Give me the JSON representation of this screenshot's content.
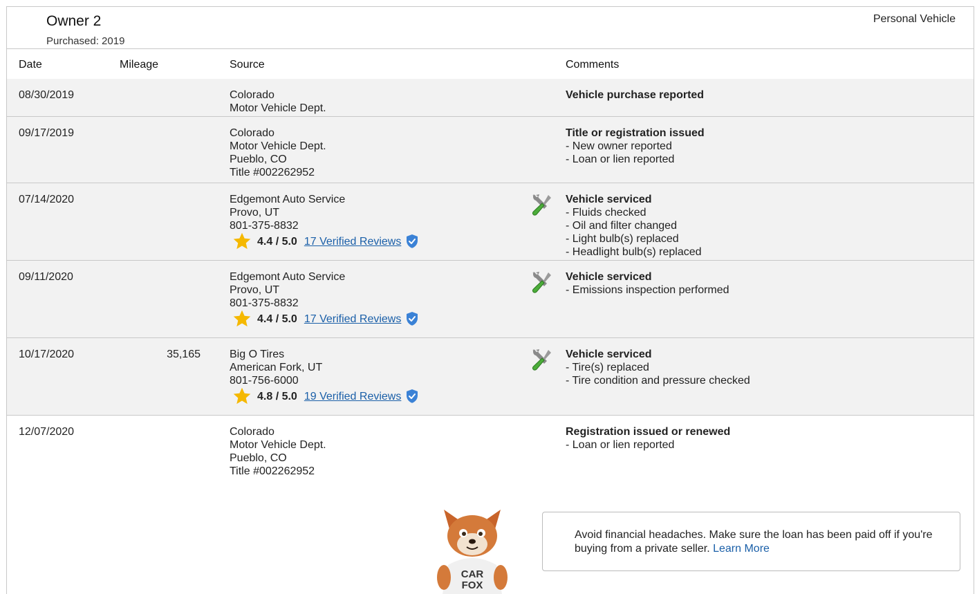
{
  "owner": {
    "title": "Owner 2",
    "purchased": "Purchased: 2019",
    "type": "Personal Vehicle"
  },
  "table": {
    "headers": {
      "date": "Date",
      "mileage": "Mileage",
      "source": "Source",
      "comments": "Comments"
    },
    "rows": [
      {
        "date": "08/30/2019",
        "mileage": "",
        "source": [
          "Colorado",
          "Motor Vehicle Dept."
        ],
        "comment_title": "Vehicle purchase reported",
        "comment_lines": []
      },
      {
        "date": "09/17/2019",
        "mileage": "",
        "source": [
          "Colorado",
          "Motor Vehicle Dept.",
          "Pueblo, CO",
          "Title #002262952"
        ],
        "comment_title": "Title or registration issued",
        "comment_lines": [
          "- New owner reported",
          "- Loan or lien reported"
        ]
      },
      {
        "date": "07/14/2020",
        "mileage": "",
        "source": [
          "Edgemont Auto Service",
          "Provo, UT",
          "801-375-8832"
        ],
        "rating": {
          "score": "4.4 / 5.0",
          "reviews": "17 Verified Reviews"
        },
        "comment_title": "Vehicle serviced",
        "comment_lines": [
          "- Fluids checked",
          "- Oil and filter changed",
          "- Light bulb(s) replaced",
          "- Headlight bulb(s) replaced"
        ]
      },
      {
        "date": "09/11/2020",
        "mileage": "",
        "source": [
          "Edgemont Auto Service",
          "Provo, UT",
          "801-375-8832"
        ],
        "rating": {
          "score": "4.4 / 5.0",
          "reviews": "17 Verified Reviews"
        },
        "comment_title": "Vehicle serviced",
        "comment_lines": [
          "- Emissions inspection performed"
        ]
      },
      {
        "date": "10/17/2020",
        "mileage": "35,165",
        "source": [
          "Big O Tires",
          "American Fork, UT",
          "801-756-6000"
        ],
        "rating": {
          "score": "4.8 / 5.0",
          "reviews": "19 Verified Reviews"
        },
        "comment_title": "Vehicle serviced",
        "comment_lines": [
          "- Tire(s) replaced",
          "- Tire condition and pressure checked"
        ]
      },
      {
        "date": "12/07/2020",
        "mileage": "",
        "source": [
          "Colorado",
          "Motor Vehicle Dept.",
          "Pueblo, CO",
          "Title #002262952"
        ],
        "comment_title": "Registration issued or renewed",
        "comment_lines": [
          "- Loan or lien reported"
        ]
      }
    ]
  },
  "tip": {
    "text": "Avoid financial headaches. Make sure the loan has been paid off if you're buying from a private seller.",
    "link": "Learn More"
  },
  "mascot": {
    "shirt_line1": "CAR",
    "shirt_line2": "FOX"
  },
  "icons": {
    "service": "wrench-screwdriver-icon",
    "star": "star-icon",
    "verified": "verified-shield-icon"
  },
  "colors": {
    "link": "#1a5fa8",
    "star": "#f5b800",
    "shield": "#3b82d6",
    "row_bg": "#f2f2f2",
    "border": "#c8c8c8"
  }
}
